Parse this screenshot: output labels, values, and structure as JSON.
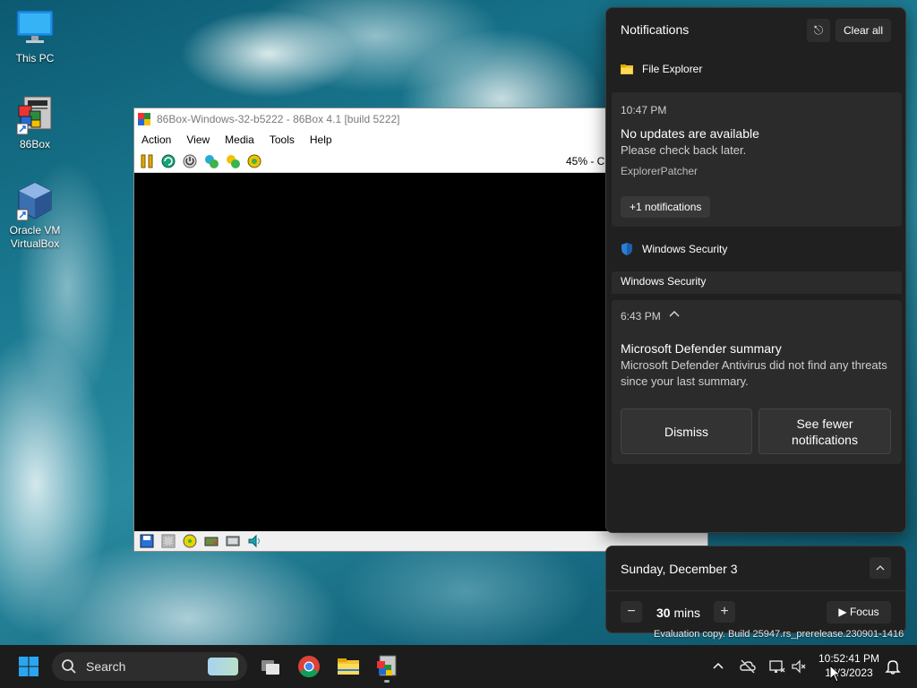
{
  "desktop": {
    "icons": [
      {
        "label": "This PC"
      },
      {
        "label": "86Box"
      },
      {
        "label": "Oracle VM\nVirtualBox"
      }
    ],
    "watermark": "Evaluation copy. Build 25947.rs_prerelease.230901-1416"
  },
  "vm_window": {
    "title": "86Box-Windows-32-b5222 - 86Box 4.1 [build 5222]",
    "menu": [
      "Action",
      "View",
      "Media",
      "Tools",
      "Help"
    ],
    "zoom_text": "45% - Cl"
  },
  "notifications": {
    "title": "Notifications",
    "clear_all": "Clear all",
    "groups": [
      {
        "app": "File Explorer",
        "time": "10:47 PM",
        "heading": "No updates are available",
        "body": "Please check back later.",
        "source": "ExplorerPatcher",
        "more": "+1 notifications"
      },
      {
        "app": "Windows Security",
        "subheader": "Windows Security",
        "time": "6:43 PM",
        "heading": "Microsoft Defender summary",
        "body": "Microsoft Defender Antivirus did not find any threats since your last summary.",
        "buttons": [
          "Dismiss",
          "See fewer notifications"
        ]
      }
    ]
  },
  "calendar": {
    "date": "Sunday, December 3",
    "focus_value": "30",
    "focus_unit": "mins",
    "focus_label": "Focus"
  },
  "taskbar": {
    "search_placeholder": "Search",
    "time": "10:52:41 PM",
    "date": "12/3/2023"
  },
  "colors": {
    "panel_bg": "#202020",
    "card_bg": "#2b2b2b",
    "taskbar_bg": "#1c1c1c",
    "accent": "#0078d4"
  }
}
